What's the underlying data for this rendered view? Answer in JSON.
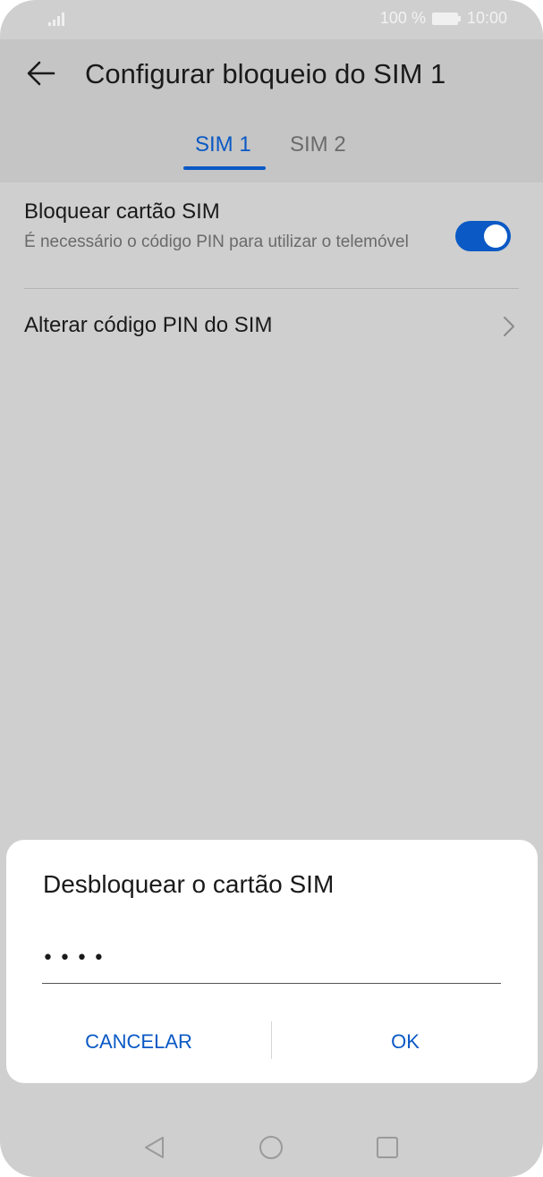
{
  "status_bar": {
    "battery_percent": "100 %",
    "time": "10:00"
  },
  "header": {
    "title": "Configurar bloqueio do SIM 1",
    "tabs": [
      {
        "label": "SIM 1",
        "selected": true
      },
      {
        "label": "SIM 2",
        "selected": false
      }
    ]
  },
  "settings": {
    "lock_sim": {
      "title": "Bloquear cartão SIM",
      "subtitle": "É necessário o código PIN para utilizar o telemóvel",
      "enabled": true
    },
    "change_pin": {
      "title": "Alterar código PIN do SIM"
    }
  },
  "dialog": {
    "title": "Desbloquear o cartão SIM",
    "pin_value": "••••",
    "cancel_label": "CANCELAR",
    "ok_label": "OK"
  },
  "colors": {
    "accent": "#0a59c5",
    "overlay_background": "#cfcfcf"
  }
}
